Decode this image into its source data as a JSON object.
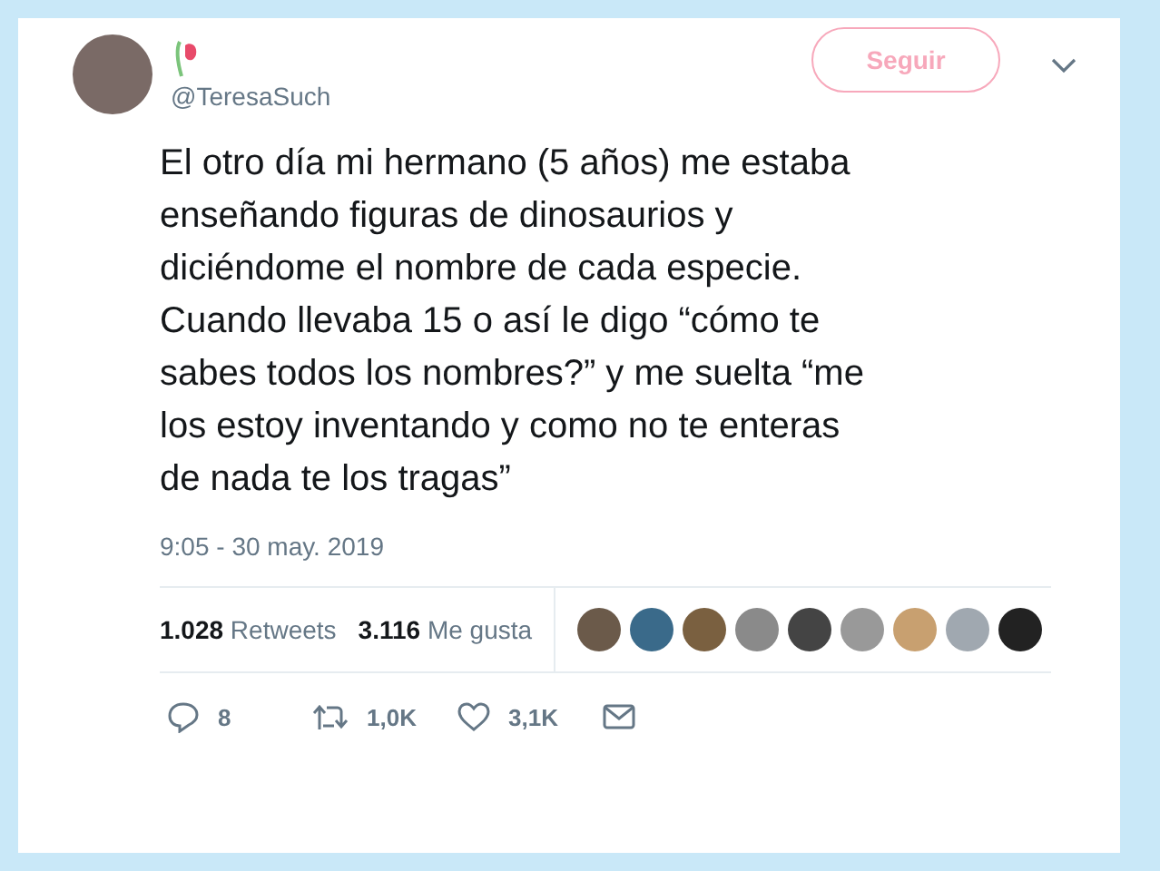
{
  "author": {
    "handle": "@TeresaSuch"
  },
  "follow_button": {
    "label": "Seguir"
  },
  "tweet": {
    "text": "El otro día mi hermano (5 años) me estaba enseñando figuras de dinosaurios y diciéndome el nombre de cada especie. Cuando llevaba 15 o así le digo “cómo te sabes todos los nombres?” y me suelta “me los estoy inventando y como no te enteras de nada te los tragas”",
    "timestamp": "9:05 - 30 may. 2019"
  },
  "stats": [
    {
      "count": "1.028",
      "label": "Retweets"
    },
    {
      "count": "3.116",
      "label": "Me gusta"
    }
  ],
  "actions": [
    {
      "kind": "reply",
      "count": "8"
    },
    {
      "kind": "retweet",
      "count": "1,0K"
    },
    {
      "kind": "like",
      "count": "3,1K"
    },
    {
      "kind": "message"
    }
  ]
}
